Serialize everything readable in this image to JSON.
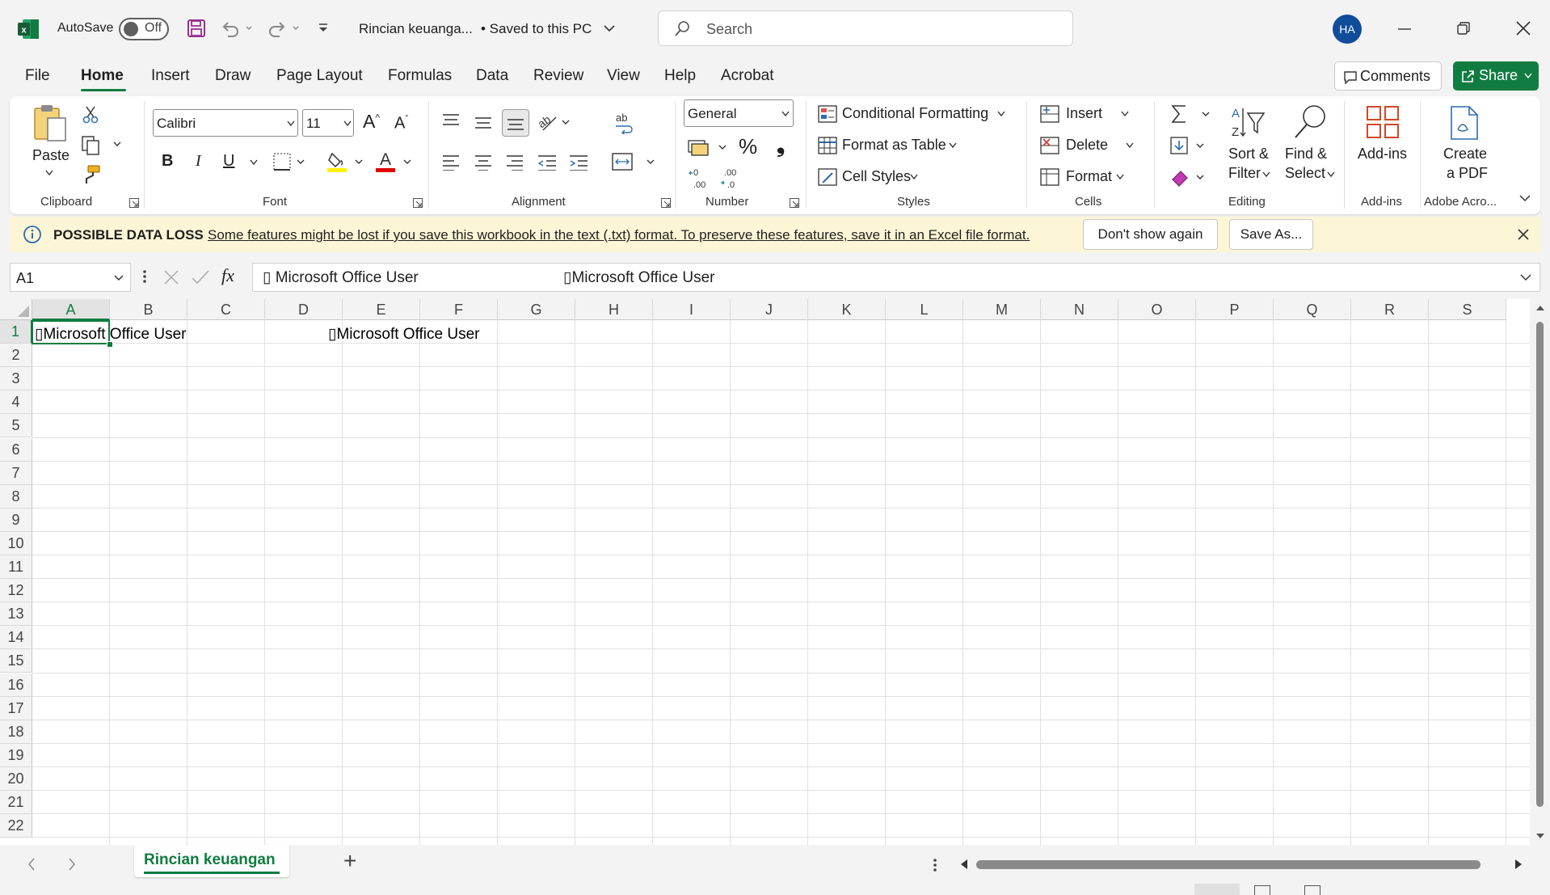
{
  "titlebar": {
    "autosave_label": "AutoSave",
    "autosave_state": "Off",
    "doc_title": "Rincian keuanga...",
    "save_status": "• Saved to this PC",
    "search_placeholder": "Search",
    "user_initials": "HA"
  },
  "menu": {
    "items": [
      "File",
      "Home",
      "Insert",
      "Draw",
      "Page Layout",
      "Formulas",
      "Data",
      "Review",
      "View",
      "Help",
      "Acrobat"
    ],
    "active": "Home",
    "comments_label": "Comments",
    "share_label": "Share"
  },
  "ribbon": {
    "clipboard": {
      "paste_label": "Paste",
      "group_label": "Clipboard"
    },
    "font": {
      "font_name": "Calibri",
      "font_size": "11",
      "bold": "B",
      "italic": "I",
      "underline": "U",
      "group_label": "Font",
      "highlight_color": "#ffef00",
      "font_color": "#e00000"
    },
    "alignment": {
      "group_label": "Alignment"
    },
    "number": {
      "format": "General",
      "percent": "%",
      "comma": "❟",
      "group_label": "Number"
    },
    "styles": {
      "conditional": "Conditional Formatting",
      "format_table": "Format as Table",
      "cell_styles": "Cell Styles",
      "group_label": "Styles"
    },
    "cells": {
      "insert": "Insert",
      "delete": "Delete",
      "format": "Format",
      "group_label": "Cells"
    },
    "editing": {
      "sort_line1": "Sort &",
      "sort_line2": "Filter",
      "find_line1": "Find &",
      "find_line2": "Select",
      "group_label": "Editing"
    },
    "addins": {
      "label": "Add-ins",
      "group_label": "Add-ins"
    },
    "adobe": {
      "line1": "Create",
      "line2": "a PDF",
      "group_label": "Adobe Acro..."
    }
  },
  "infobar": {
    "title": "POSSIBLE DATA LOSS",
    "message": "Some features might be lost if you save this workbook in the text (.txt) format. To preserve these features, save it in an Excel file format.",
    "dont_show": "Don't show again",
    "save_as": "Save As..."
  },
  "formula_bar": {
    "name_box": "A1",
    "fx": "fx",
    "content_a": "▯ Microsoft Office User",
    "content_b": "▯Microsoft Office User"
  },
  "sheet": {
    "columns": [
      "A",
      "B",
      "C",
      "D",
      "E",
      "F",
      "G",
      "H",
      "I",
      "J",
      "K",
      "L",
      "M",
      "N",
      "O",
      "P",
      "Q",
      "R",
      "S"
    ],
    "rows": [
      "1",
      "2",
      "3",
      "4",
      "5",
      "6",
      "7",
      "8",
      "9",
      "10",
      "11",
      "12",
      "13",
      "14",
      "15",
      "16",
      "17",
      "18",
      "19",
      "20",
      "21",
      "22"
    ],
    "cell_a1": "▯Microsoft Office User",
    "cell_d1": "▯Microsoft Office User"
  },
  "tabs": {
    "active_sheet": "Rincian keuangan",
    "add_label": "+"
  },
  "colors": {
    "excel_green": "#107c41",
    "info_bg": "#fcf6d6",
    "save_purple": "#9b2f8f"
  }
}
